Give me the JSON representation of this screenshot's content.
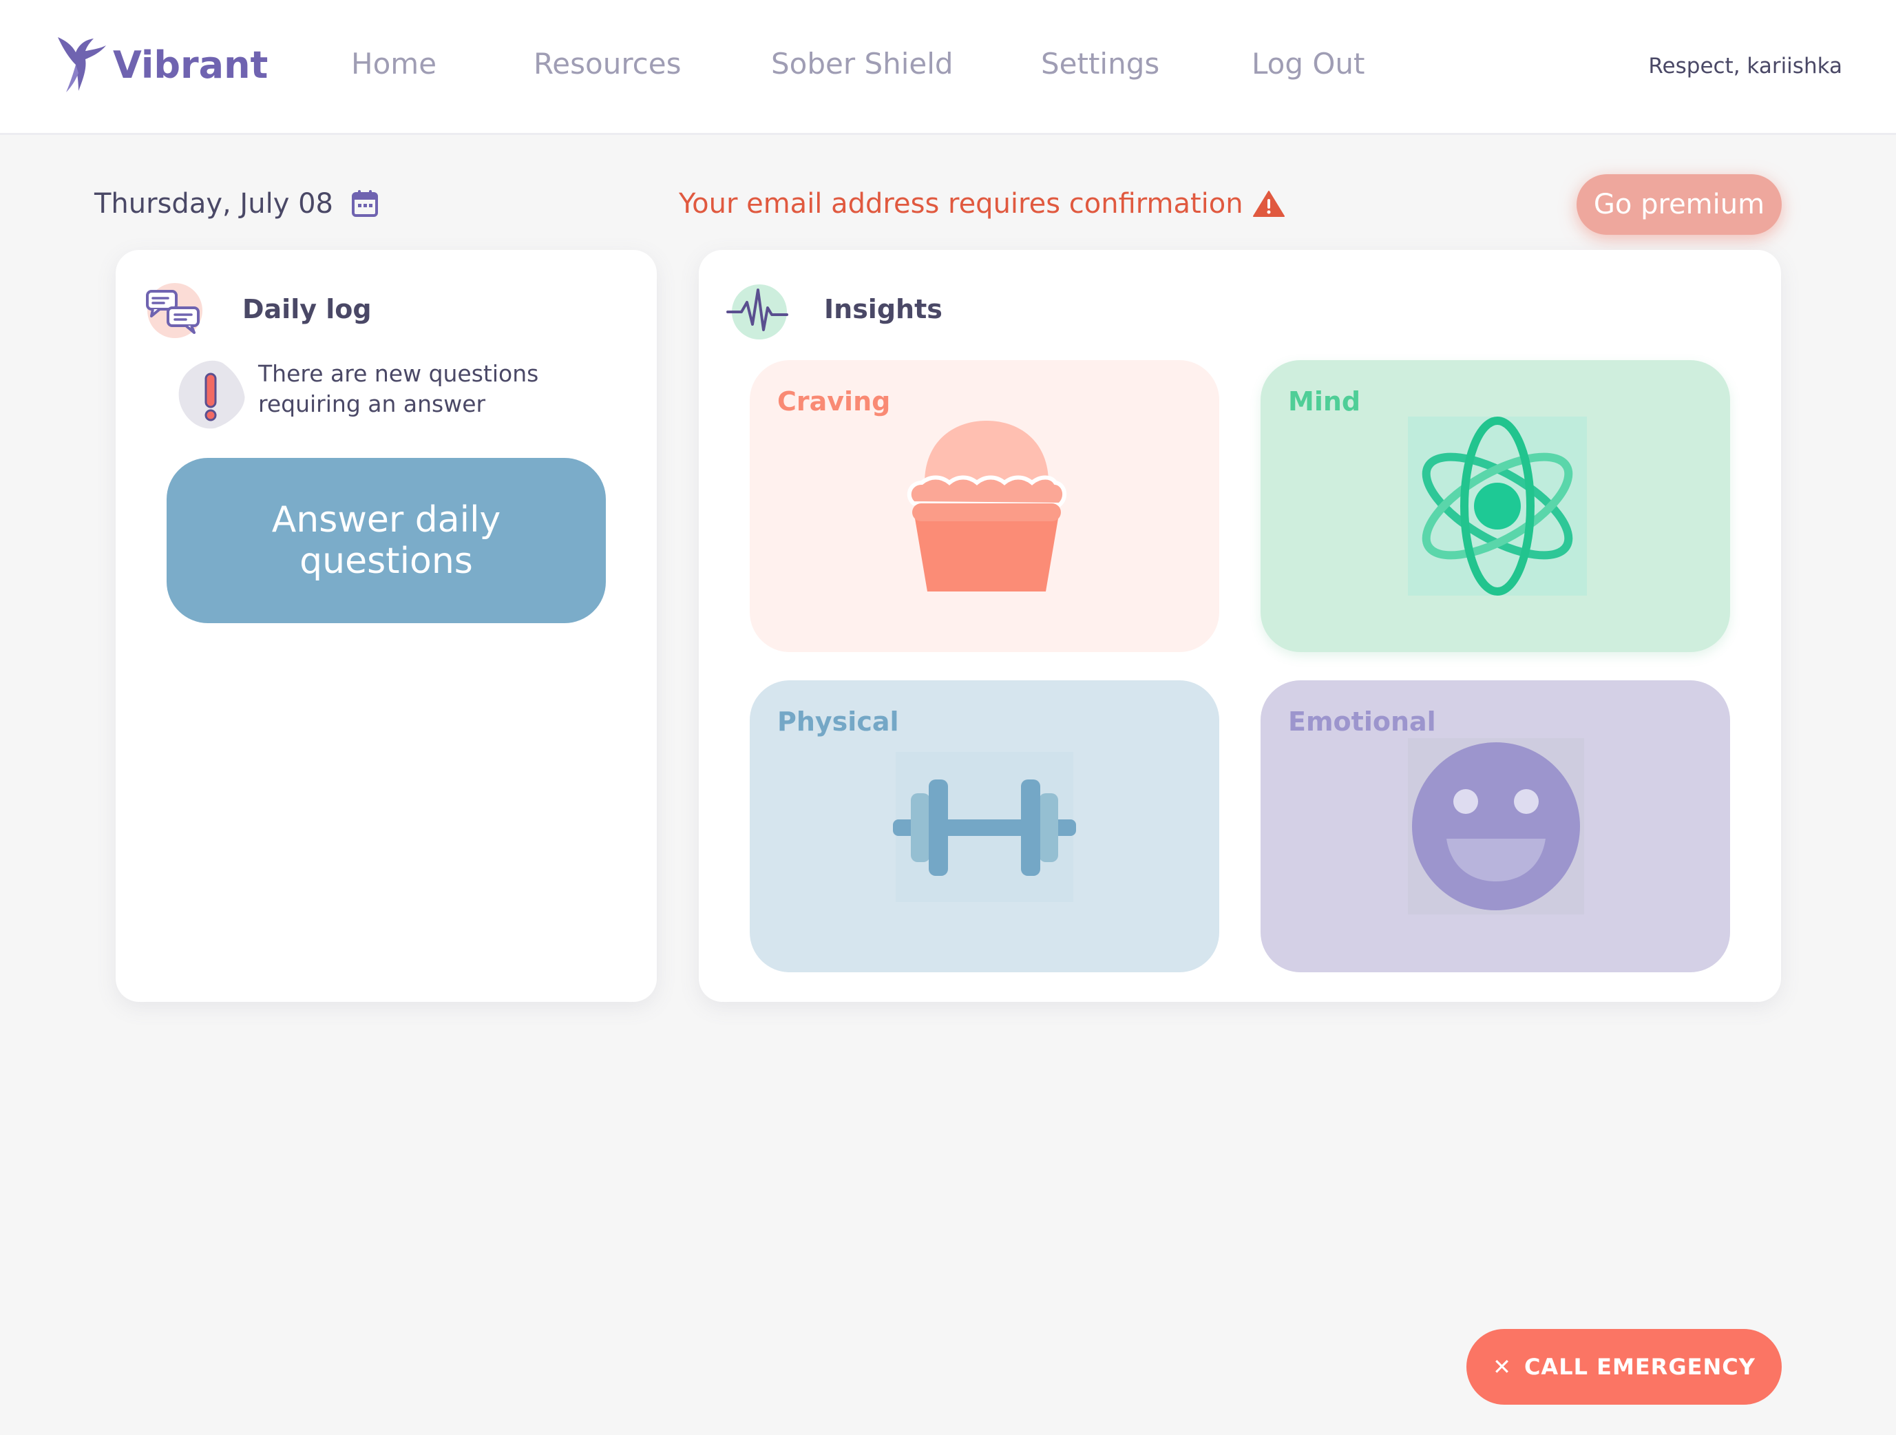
{
  "app": {
    "name": "Vibrant",
    "brand_color": "#6f63b0"
  },
  "nav": {
    "items": [
      {
        "label": "Home"
      },
      {
        "label": "Resources"
      },
      {
        "label": "Sober Shield"
      },
      {
        "label": "Settings"
      },
      {
        "label": "Log Out"
      }
    ]
  },
  "user": {
    "greeting": "Respect, kariishka"
  },
  "topbar": {
    "date": "Thursday, July 08",
    "date_icon": "calendar-icon",
    "email_warning": "Your email address requires confirmation",
    "warning_icon": "warning-triangle-icon",
    "warning_color": "#e0593f",
    "premium_label": "Go premium"
  },
  "daily_log": {
    "title": "Daily log",
    "icon": "chat-bubbles-icon",
    "notice_icon": "exclamation-icon",
    "notice": "There are new questions requiring an answer",
    "button_label": "Answer daily questions",
    "button_color": "#7bacc9"
  },
  "insights": {
    "title": "Insights",
    "icon": "heartbeat-icon",
    "tiles": [
      {
        "label": "Craving",
        "icon": "cupcake-icon",
        "color": "#f98a74",
        "bg": "#fff1ee"
      },
      {
        "label": "Mind",
        "icon": "atom-icon",
        "color": "#23c993",
        "bg": "#cfeedd"
      },
      {
        "label": "Physical",
        "icon": "dumbbell-icon",
        "color": "#74a7c6",
        "bg": "#d6e5ee"
      },
      {
        "label": "Emotional",
        "icon": "smiley-icon",
        "color": "#9c95cd",
        "bg": "#d4d0e6"
      }
    ]
  },
  "emergency": {
    "label": "CALL EMERGENCY",
    "icon": "close-icon",
    "color": "#fb7564"
  }
}
